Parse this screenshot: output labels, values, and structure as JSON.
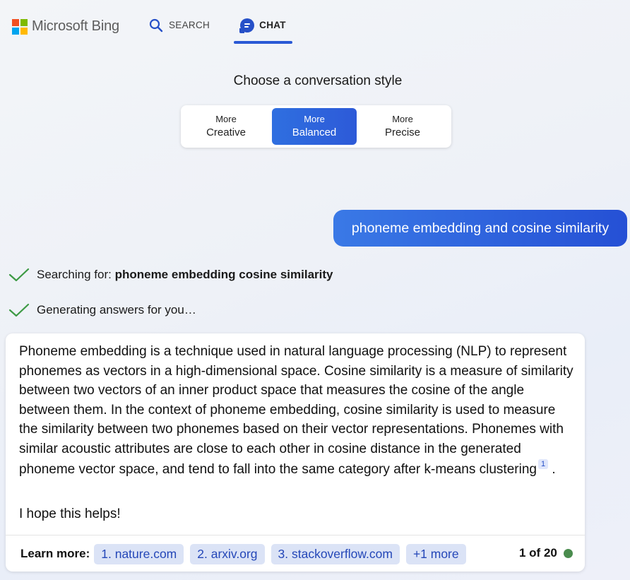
{
  "header": {
    "brand": "Microsoft Bing",
    "tabs": [
      {
        "label": "SEARCH",
        "icon": "search-icon",
        "active": false
      },
      {
        "label": "CHAT",
        "icon": "chat-icon",
        "active": true
      }
    ]
  },
  "style_picker": {
    "title": "Choose a conversation style",
    "options": [
      {
        "top": "More",
        "bottom": "Creative",
        "active": false
      },
      {
        "top": "More",
        "bottom": "Balanced",
        "active": true
      },
      {
        "top": "More",
        "bottom": "Precise",
        "active": false
      }
    ]
  },
  "user_message": "phoneme embedding and cosine similarity",
  "status": {
    "searching_prefix": "Searching for: ",
    "searching_query": "phoneme embedding cosine similarity",
    "generating": "Generating answers for you…"
  },
  "answer": {
    "paragraph": "Phoneme embedding is a technique used in natural language processing (NLP) to represent phonemes as vectors in a high-dimensional space. Cosine similarity is a measure of similarity between two vectors of an inner product space that measures the cosine of the angle between them. In the context of phoneme embedding, cosine similarity is used to measure the similarity between two phonemes based on their vector representations. Phonemes with similar acoustic attributes are close to each other in cosine distance in the generated phoneme vector space, and tend to fall into the same category after k-means clustering",
    "citation": "1",
    "end": ".",
    "closing": "I hope this helps!"
  },
  "learn_more": {
    "label": "Learn more:",
    "links": [
      "1. nature.com",
      "2. arxiv.org",
      "3. stackoverflow.com",
      "+1 more"
    ]
  },
  "counter": "1 of 20",
  "colors": {
    "accent": "#2a59d5",
    "status_dot": "#4a8c4e",
    "check": "#3d9a44",
    "ms_red": "#f25022",
    "ms_green": "#7fba00",
    "ms_blue": "#00a4ef",
    "ms_yellow": "#ffb900"
  }
}
